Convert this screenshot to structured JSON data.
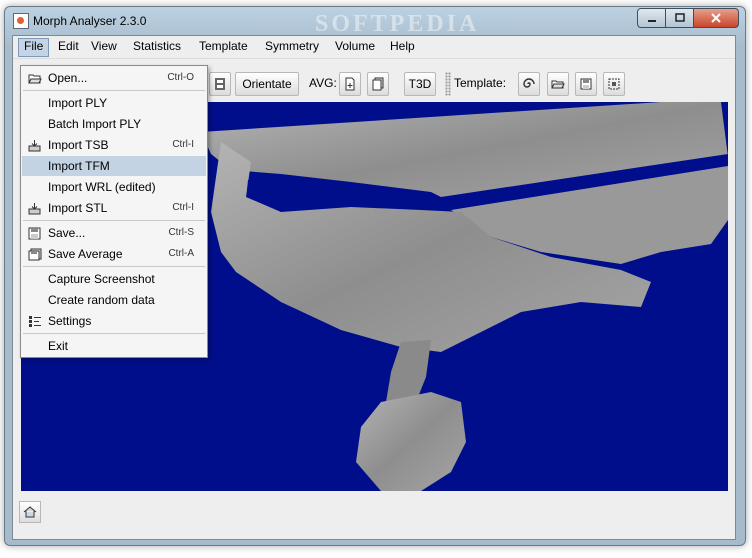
{
  "window": {
    "title": "Morph Analyser 2.3.0",
    "watermark": "SOFTPEDIA"
  },
  "menubar": {
    "items": [
      {
        "label": "File"
      },
      {
        "label": "Edit"
      },
      {
        "label": "View"
      },
      {
        "label": "Statistics"
      },
      {
        "label": "Template"
      },
      {
        "label": "Symmetry"
      },
      {
        "label": "Volume"
      },
      {
        "label": "Help"
      }
    ]
  },
  "toolbar": {
    "orientate_label": "Orientate",
    "avg_label": "AVG:",
    "t3d_label": "T3D",
    "template_label": "Template:"
  },
  "file_menu": {
    "items": [
      {
        "label": "Open...",
        "shortcut": "Ctrl-O",
        "icon": "folder-open-icon"
      },
      {
        "label": "Import PLY",
        "shortcut": ""
      },
      {
        "label": "Batch Import PLY",
        "shortcut": ""
      },
      {
        "label": "Import TSB",
        "shortcut": "Ctrl-I",
        "icon": "import-icon"
      },
      {
        "label": "Import TFM",
        "shortcut": "",
        "highlighted": true
      },
      {
        "label": "Import WRL (edited)",
        "shortcut": ""
      },
      {
        "label": "Import STL",
        "shortcut": "Ctrl-I",
        "icon": "import-icon"
      },
      {
        "label": "Save...",
        "shortcut": "Ctrl-S",
        "icon": "save-icon"
      },
      {
        "label": "Save Average",
        "shortcut": "Ctrl-A",
        "icon": "save-average-icon"
      },
      {
        "label": "Capture Screenshot",
        "shortcut": ""
      },
      {
        "label": "Create random data",
        "shortcut": ""
      },
      {
        "label": "Settings",
        "shortcut": "",
        "icon": "settings-icon"
      },
      {
        "label": "Exit",
        "shortcut": ""
      }
    ]
  },
  "colors": {
    "viewport_bg": "#000e8b",
    "mesh": "#9a9a9a",
    "menu_highlight": "#c3d3e4"
  }
}
